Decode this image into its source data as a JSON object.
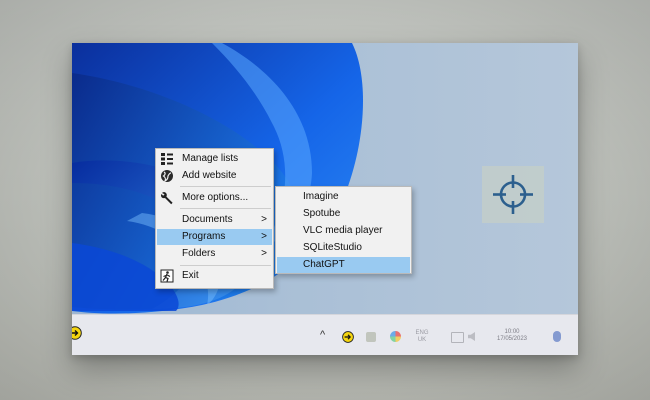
{
  "context_menu": {
    "items": [
      {
        "label": "Manage lists",
        "icon": "list-icon",
        "has_submenu": false
      },
      {
        "label": "Add website",
        "icon": "globe-icon",
        "has_submenu": false
      },
      {
        "label": "More options...",
        "icon": "wrench-icon",
        "has_submenu": false
      },
      {
        "label": "Documents",
        "icon": "",
        "has_submenu": true
      },
      {
        "label": "Programs",
        "icon": "",
        "has_submenu": true,
        "highlighted": true
      },
      {
        "label": "Folders",
        "icon": "",
        "has_submenu": true
      },
      {
        "label": "Exit",
        "icon": "exit-icon",
        "has_submenu": false
      }
    ],
    "submenu_arrow": ">"
  },
  "programs_submenu": {
    "items": [
      {
        "label": "Imagine"
      },
      {
        "label": "Spotube"
      },
      {
        "label": "VLC media player"
      },
      {
        "label": "SQLiteStudio"
      },
      {
        "label": "ChatGPT",
        "highlighted": true
      }
    ]
  },
  "taskbar": {
    "overflow_chevron": "^",
    "tray_time": "10:00",
    "tray_date": "17/05/2023"
  },
  "colors": {
    "menu_highlight": "#99caf1",
    "wallpaper_blue": "#0a3fd0",
    "desktop_bg": "#a9bfd6",
    "tray_icon_yellow": "#f5d50e"
  }
}
